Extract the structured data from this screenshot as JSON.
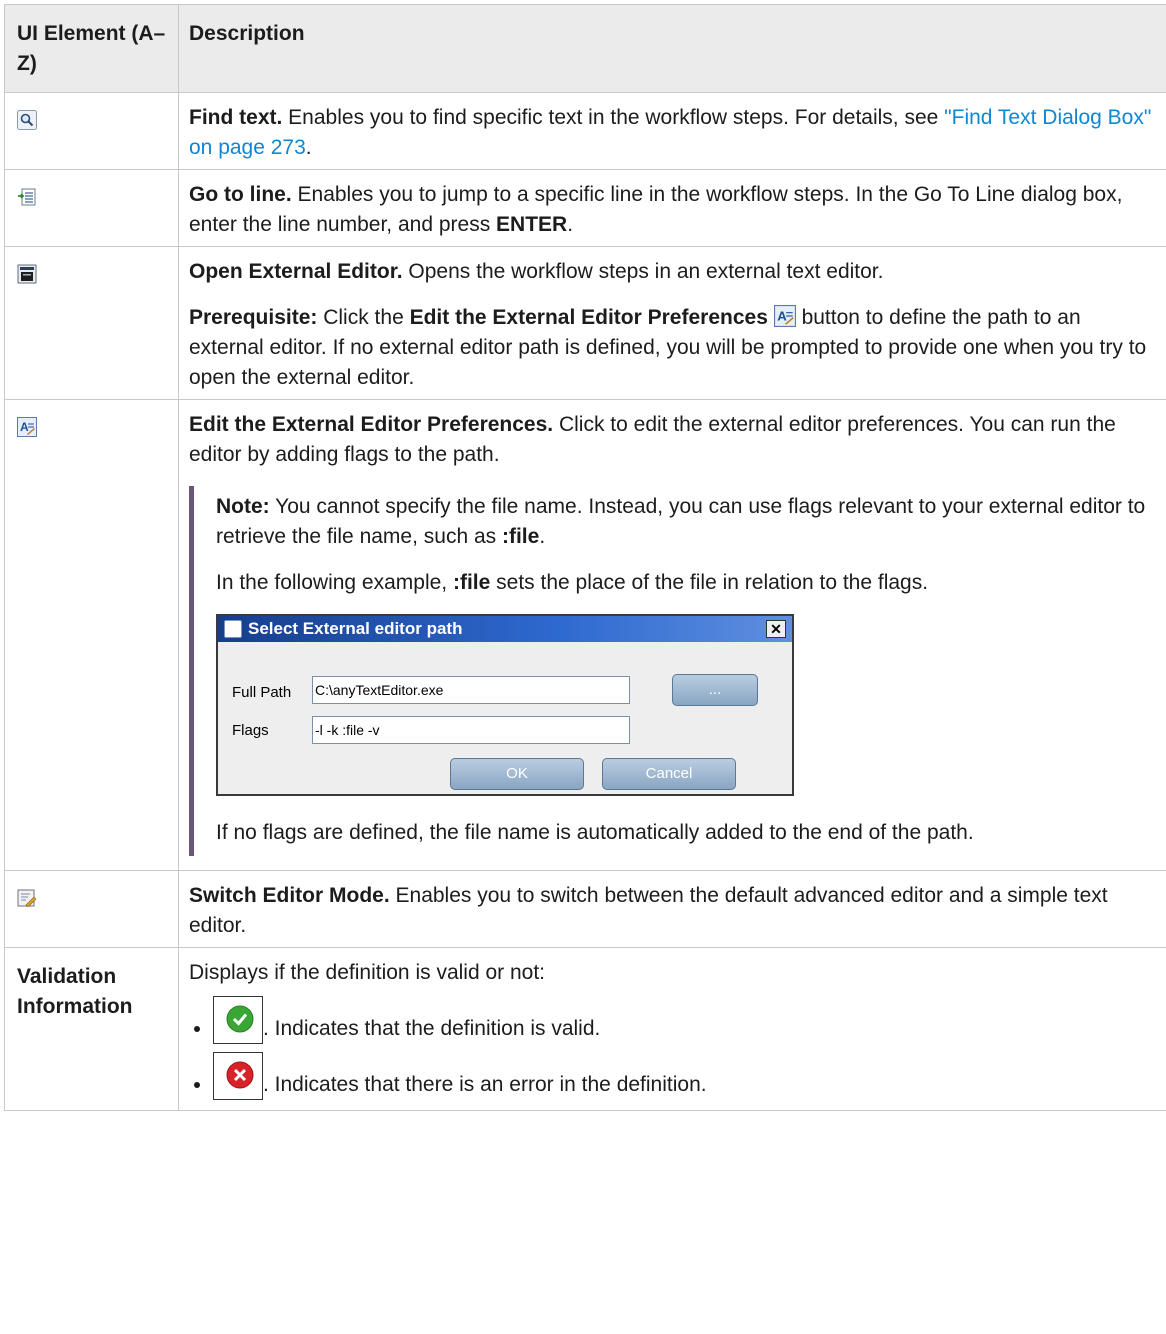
{
  "header": {
    "col1": "UI Element (A–Z)",
    "col2": "Description"
  },
  "rows": {
    "find": {
      "icon": "magnifier-icon",
      "title": "Find text.",
      "text": " Enables you to find specific text in the workflow steps. For details, see ",
      "link": "\"Find Text Dialog Box\" on page 273",
      "after": "."
    },
    "goto": {
      "icon": "go-to-line-icon",
      "title": "Go to line.",
      "text": " Enables you to jump to a specific line in the workflow steps. In the Go To Line dialog box, enter the line number, and press ",
      "key": "ENTER",
      "after": "."
    },
    "external": {
      "icon": "external-editor-icon",
      "title": "Open External Editor.",
      "text": " Opens the workflow steps in an external text editor.",
      "prereq_label": "Prerequisite:",
      "prereq_text1": " Click the ",
      "prereq_bold": "Edit the External Editor Preferences",
      "prereq_text2": " button to define the path to an external editor. If no external editor path is defined, you will be prompted to provide one when you try to open the external editor."
    },
    "prefs": {
      "icon": "editor-preferences-icon",
      "title": "Edit the External Editor Preferences.",
      "text": " Click to edit the external editor preferences. You can run the editor by adding flags to the path.",
      "note_label": "Note:",
      "note_text": "  You cannot specify the file name. Instead, you can use flags relevant to your external editor to retrieve the file name, such as ",
      "note_flag": ":file",
      "note_after": ".",
      "example_text1": "In the following example, ",
      "example_flag": ":file",
      "example_text2": " sets the place of the file in relation to the flags.",
      "dialog": {
        "title": "Select External editor path",
        "close": "✕",
        "full_path_label": "Full Path",
        "full_path_value": "C:\\anyTextEditor.exe",
        "browse_label": "...",
        "flags_label": "Flags",
        "flags_value": "-l -k :file -v",
        "ok_label": "OK",
        "cancel_label": "Cancel"
      },
      "footer": "If no flags are defined, the file name is automatically added to the end of the path."
    },
    "switch": {
      "icon": "switch-editor-mode-icon",
      "title": "Switch Editor Mode.",
      "text": " Enables you to switch between the default advanced editor and a simple text editor."
    },
    "validation": {
      "name": "Validation Information",
      "text": "Displays if the definition is valid or not:",
      "valid_text": ". Indicates that the definition is valid.",
      "error_text": ". Indicates that there is an error in the definition."
    }
  },
  "colors": {
    "link": "#0e86d4",
    "note_bar": "#6a5676",
    "valid": "#3aa635",
    "error": "#d8222a"
  }
}
